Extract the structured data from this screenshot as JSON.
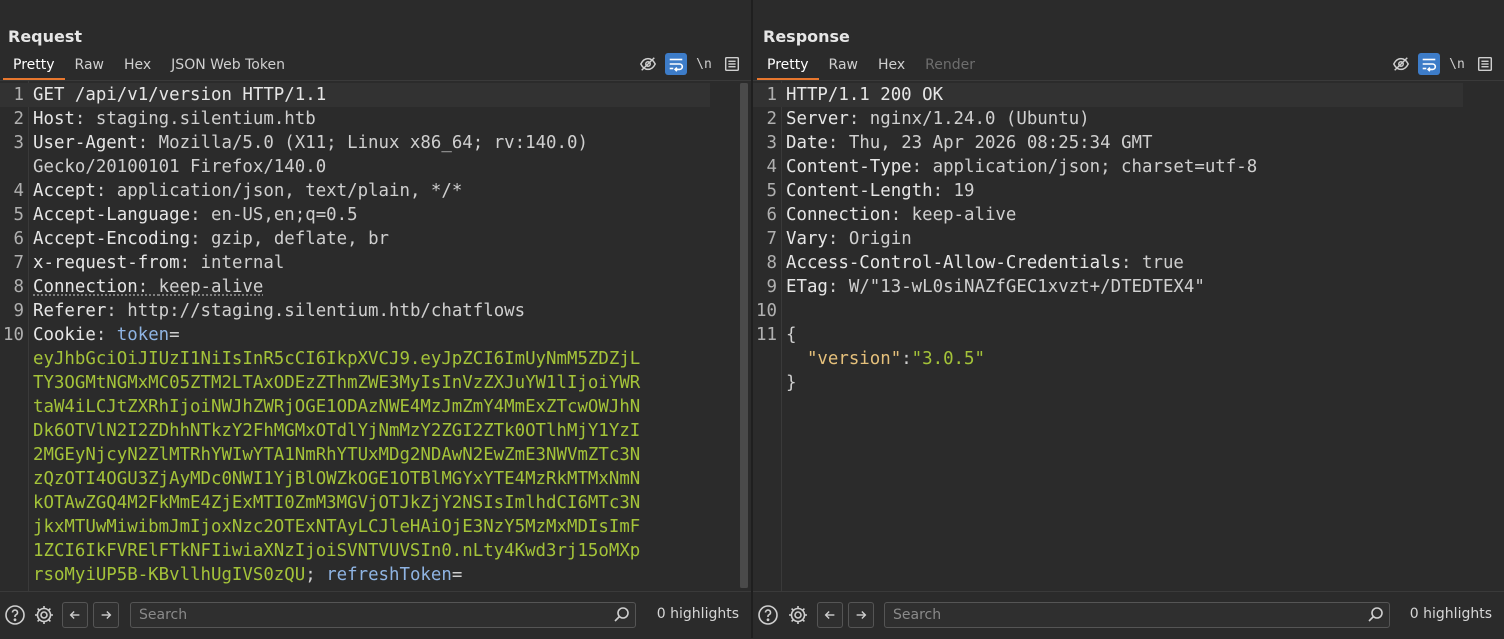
{
  "request": {
    "title": "Request",
    "tabs": [
      {
        "label": "Pretty",
        "active": true
      },
      {
        "label": "Raw"
      },
      {
        "label": "Hex"
      },
      {
        "label": "JSON Web Token"
      }
    ],
    "newline_toggle": "\\n",
    "lines": [
      {
        "n": "1",
        "k": "GET /api/v1/version HTTP/1.1",
        "v": ""
      },
      {
        "n": "2",
        "k": "Host",
        "v": "staging.silentium.htb"
      },
      {
        "n": "3",
        "k": "User-Agent",
        "v": "Mozilla/5.0 (X11; Linux x86_64; rv:140.0)"
      },
      {
        "n": "",
        "k": "",
        "v": "Gecko/20100101 Firefox/140.0"
      },
      {
        "n": "4",
        "k": "Accept",
        "v": "application/json, text/plain, */*"
      },
      {
        "n": "5",
        "k": "Accept-Language",
        "v": "en-US,en;q=0.5"
      },
      {
        "n": "6",
        "k": "Accept-Encoding",
        "v": "gzip, deflate, br"
      },
      {
        "n": "7",
        "k": "x-request-from",
        "v": "internal"
      },
      {
        "n": "8",
        "k": "Connection",
        "v": "keep-alive"
      },
      {
        "n": "9",
        "k": "Referer",
        "v": "http://staging.silentium.htb/chatflows"
      },
      {
        "n": "10",
        "k": "Cookie",
        "v": ""
      }
    ],
    "cookie_name_1": "token",
    "token_lines": [
      "eyJhbGciOiJIUzI1NiIsInR5cCI6IkpXVCJ9.eyJpZCI6ImUyNmM5ZDZjL",
      "TY3OGMtNGMxMC05ZTM2LTAxODEzZThmZWE3MyIsInVzZXJuYW1lIjoiYWR",
      "taW4iLCJtZXRhIjoiNWJhZWRjOGE1ODAzNWE4MzJmZmY4MmExZTcwOWJhN",
      "Dk6OTVlN2I2ZDhhNTkzY2FhMGMxOTdlYjNmMzY2ZGI2ZTk0OTlhMjY1YzI",
      "2MGEyNjcyN2ZlMTRhYWIwYTA1NmRhYTUxMDg2NDAwN2EwZmE3NWVmZTc3N",
      "zQzOTI4OGU3ZjAyMDc0NWI1YjBlOWZkOGE1OTBlMGYxYTE4MzRkMTMxNmN",
      "kOTAwZGQ4M2FkMmE4ZjExMTI0ZmM3MGVjOTJkZjY2NSIsImlhdCI6MTc3N",
      "jkxMTUwMiwibmJmIjoxNzc2OTExNTAyLCJleHAiOjE3NzY5MzMxMDIsImF",
      "1ZCI6IkFVRElFTkNFIiwiaXNzIjoiSVNTVUVSIn0.nLty4Kwd3rj15oMXp",
      "rsoMyiUP5B-KBvllhUgIVS0zQU"
    ],
    "cookie_name_2": "refreshToken",
    "search_placeholder": "Search",
    "highlights": "0 highlights"
  },
  "response": {
    "title": "Response",
    "tabs": [
      {
        "label": "Pretty",
        "active": true
      },
      {
        "label": "Raw"
      },
      {
        "label": "Hex"
      },
      {
        "label": "Render",
        "disabled": true
      }
    ],
    "newline_toggle": "\\n",
    "lines": [
      {
        "n": "1",
        "k": "HTTP/1.1 200 OK",
        "v": ""
      },
      {
        "n": "2",
        "k": "Server",
        "v": "nginx/1.24.0 (Ubuntu)"
      },
      {
        "n": "3",
        "k": "Date",
        "v": "Thu, 23 Apr 2026 08:25:34 GMT"
      },
      {
        "n": "4",
        "k": "Content-Type",
        "v": "application/json; charset=utf-8"
      },
      {
        "n": "5",
        "k": "Content-Length",
        "v": "19"
      },
      {
        "n": "6",
        "k": "Connection",
        "v": "keep-alive"
      },
      {
        "n": "7",
        "k": "Vary",
        "v": "Origin"
      },
      {
        "n": "8",
        "k": "Access-Control-Allow-Credentials",
        "v": "true"
      },
      {
        "n": "9",
        "k": "ETag",
        "v": "W/\"13-wL0siNAZfGEC1xvzt+/DTEDTEX4\""
      },
      {
        "n": "10",
        "k": "",
        "v": ""
      }
    ],
    "body": {
      "open": "{",
      "key": "\"version\"",
      "colon": ":",
      "value": "\"3.0.5\"",
      "close": "}",
      "n_open": "11"
    },
    "search_placeholder": "Search",
    "highlights": "0 highlights"
  },
  "colors": {
    "accent_tab": "#e8772e",
    "toggle_on": "#3d7cc8",
    "token_green": "#a4c339",
    "json_key": "#e5c07b",
    "cookie_name": "#8fb4e3"
  }
}
